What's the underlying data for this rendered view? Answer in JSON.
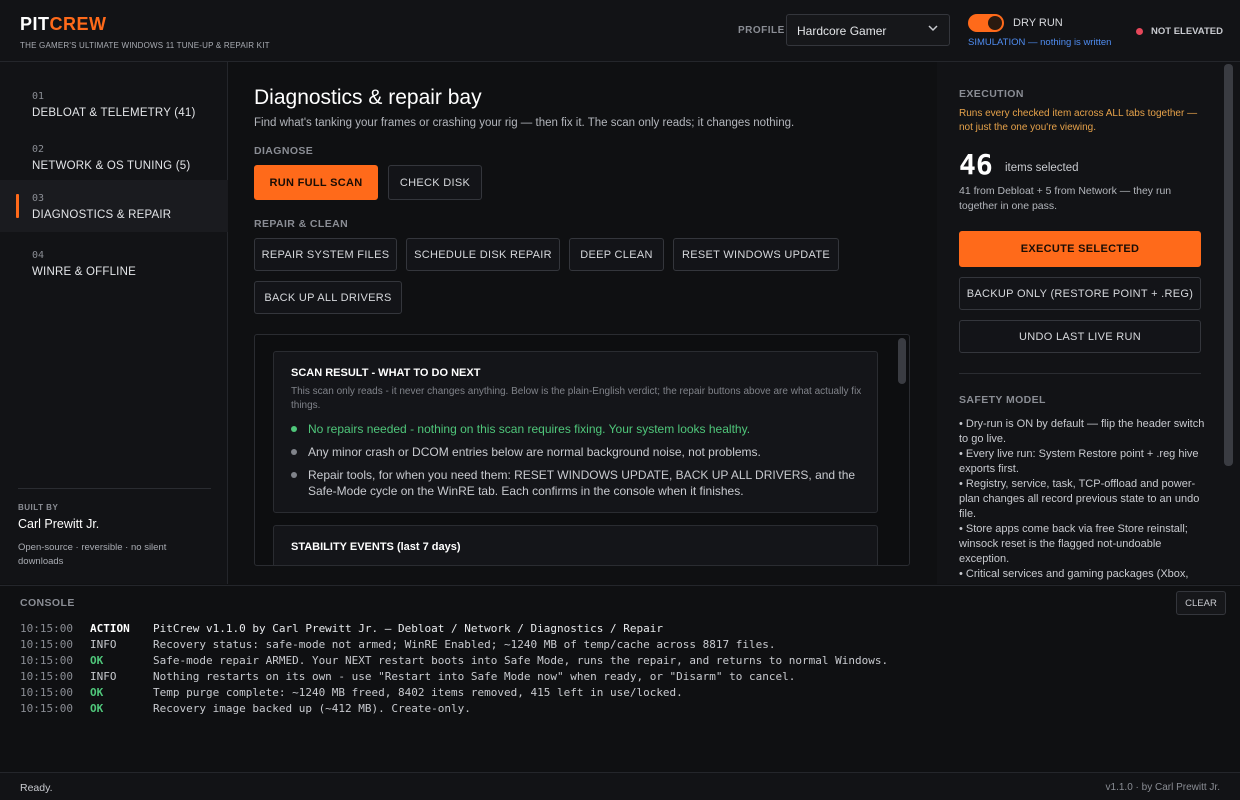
{
  "header": {
    "brand_a": "PIT",
    "brand_b": "CREW",
    "tagline": "THE GAMER'S ULTIMATE WINDOWS 11 TUNE-UP & REPAIR KIT",
    "profile_label": "PROFILE",
    "profile_value": "Hardcore Gamer",
    "dry_run_label": "DRY RUN",
    "dry_run_on": true,
    "simulation_note": "SIMULATION — nothing is written",
    "elevation": "NOT ELEVATED",
    "accent_color": "#ff6a1a"
  },
  "sidebar": {
    "items": [
      {
        "num": "01",
        "label": "DEBLOAT & TELEMETRY  (41)",
        "active": false
      },
      {
        "num": "02",
        "label": "NETWORK & OS TUNING  (5)",
        "active": false
      },
      {
        "num": "03",
        "label": "DIAGNOSTICS & REPAIR",
        "active": true
      },
      {
        "num": "04",
        "label": "WINRE & OFFLINE",
        "active": false
      }
    ],
    "built_by_label": "BUILT BY",
    "built_by_name": "Carl Prewitt Jr.",
    "built_by_note": "Open-source · reversible · no silent downloads"
  },
  "main": {
    "title": "Diagnostics & repair bay",
    "subtitle": "Find what's tanking your frames or crashing your rig — then fix it. The scan only reads; it changes nothing.",
    "diagnose_label": "DIAGNOSE",
    "diagnose_buttons": [
      "RUN FULL SCAN",
      "CHECK DISK"
    ],
    "repair_label": "REPAIR & CLEAN",
    "repair_buttons": [
      "REPAIR SYSTEM FILES",
      "SCHEDULE DISK REPAIR",
      "DEEP CLEAN",
      "RESET WINDOWS UPDATE",
      "BACK UP ALL DRIVERS"
    ],
    "result": {
      "title": "SCAN RESULT - WHAT TO DO NEXT",
      "note": "This scan only reads - it never changes anything. Below is the plain-English verdict; the repair buttons above are what actually fix things.",
      "bullets": [
        "No repairs needed - nothing on this scan requires fixing. Your system looks healthy.",
        "Any minor crash or DCOM entries below are normal background noise, not problems.",
        "Repair tools, for when you need them: RESET WINDOWS UPDATE, BACK UP ALL DRIVERS, and the Safe-Mode cycle on the WinRE tab. Each confirms in the console when it finishes."
      ]
    },
    "stability_title": "STABILITY EVENTS (last 7 days)"
  },
  "right": {
    "execution_label": "EXECUTION",
    "warning": "Runs every checked item across ALL tabs together — not just the one you're viewing.",
    "count": "46",
    "count_label": "items selected",
    "from": "41 from Debloat + 5 from Network — they run together in one pass.",
    "execute_label": "EXECUTE SELECTED",
    "backup_label": "BACKUP ONLY (RESTORE POINT + .REG)",
    "undo_label": "UNDO LAST LIVE RUN",
    "safety_label": "SAFETY MODEL",
    "safety": [
      "• Dry-run is ON by default — flip the header switch to go live.",
      "• Every live run: System Restore point + .reg hive exports first.",
      "• Registry, service, task, TCP-offload and power-plan changes all record previous state to an undo file.",
      "• Store apps come back via free Store reinstall; winsock reset is the flagged not-undoable exception.",
      "• Critical services and gaming packages (Xbox,"
    ]
  },
  "console": {
    "label": "CONSOLE",
    "clear_label": "CLEAR",
    "lines": [
      {
        "ts": "10:15:00",
        "level": "ACTION",
        "msg": "PitCrew v1.1.0 by Carl Prewitt Jr. — Debloat / Network / Diagnostics / Repair"
      },
      {
        "ts": "10:15:00",
        "level": "INFO",
        "msg": "Recovery status: safe-mode not armed; WinRE Enabled; ~1240 MB of temp/cache across 8817 files."
      },
      {
        "ts": "10:15:00",
        "level": "OK",
        "msg": "Safe-mode repair ARMED. Your NEXT restart boots into Safe Mode, runs the repair, and returns to normal Windows."
      },
      {
        "ts": "10:15:00",
        "level": "INFO",
        "msg": "Nothing restarts on its own - use \"Restart into Safe Mode now\" when ready, or \"Disarm\" to cancel."
      },
      {
        "ts": "10:15:00",
        "level": "OK",
        "msg": "Temp purge complete: ~1240 MB freed, 8402 items removed, 415 left in use/locked."
      },
      {
        "ts": "10:15:00",
        "level": "OK",
        "msg": "Recovery image backed up (~412 MB). Create-only."
      }
    ]
  },
  "status": {
    "left": "Ready.",
    "right": "v1.1.0 · by Carl Prewitt Jr."
  }
}
